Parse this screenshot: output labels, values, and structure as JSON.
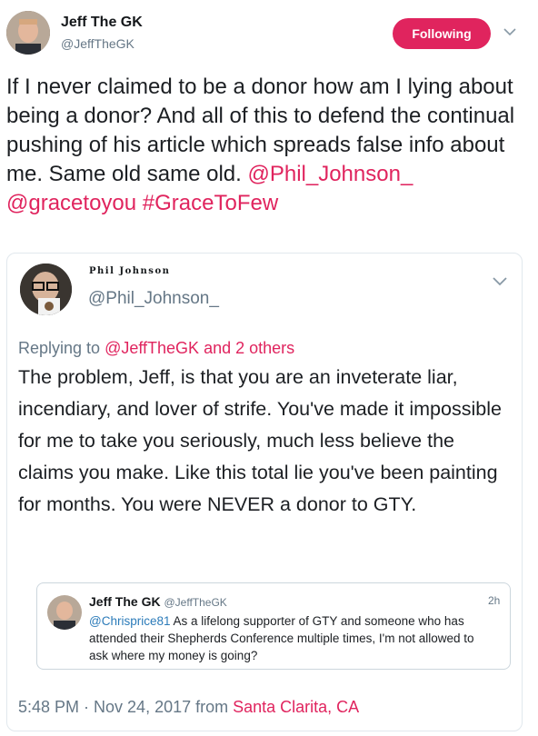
{
  "tweet": {
    "author_name": "Jeff The GK",
    "author_handle": "@JeffTheGK",
    "follow_label": "Following",
    "text_plain": "If I never claimed to be a donor how am I lying about being a donor? And all of this to defend the continual pushing of his article which spreads false info about me. Same old same old.",
    "mention1": "@Phil_Johnson_",
    "mention2": "@gracetoyou",
    "hashtag": "#GraceToFew"
  },
  "quoted": {
    "author_name": "Phil Johnson",
    "author_handle": "@Phil_Johnson_",
    "replying_prefix": "Replying to",
    "replying_to": "@JeffTheGK and 2 others",
    "text": "The problem, Jeff, is that you are an inveterate liar, incendiary, and lover of strife. You've made it impossible for me to take you seriously, much less believe the claims you make. Like this total lie you've been painting for months. You were NEVER a donor to GTY.",
    "timestamp": "5:48 PM · Nov 24, 2017 from",
    "location": "Santa Clarita, CA"
  },
  "inner_quote": {
    "author_name": "Jeff The GK",
    "author_handle": "@JeffTheGK",
    "time": "2h",
    "mention": "@Chrisprice81",
    "text": "As a lifelong supporter of GTY and someone who has attended their Shepherds Conference multiple times, I'm not allowed to ask where my money is going?"
  },
  "colors": {
    "accent": "#e0245e",
    "muted": "#657786",
    "border": "#e1e8ed"
  },
  "icons": [
    "chevron-down-icon",
    "avatar"
  ]
}
